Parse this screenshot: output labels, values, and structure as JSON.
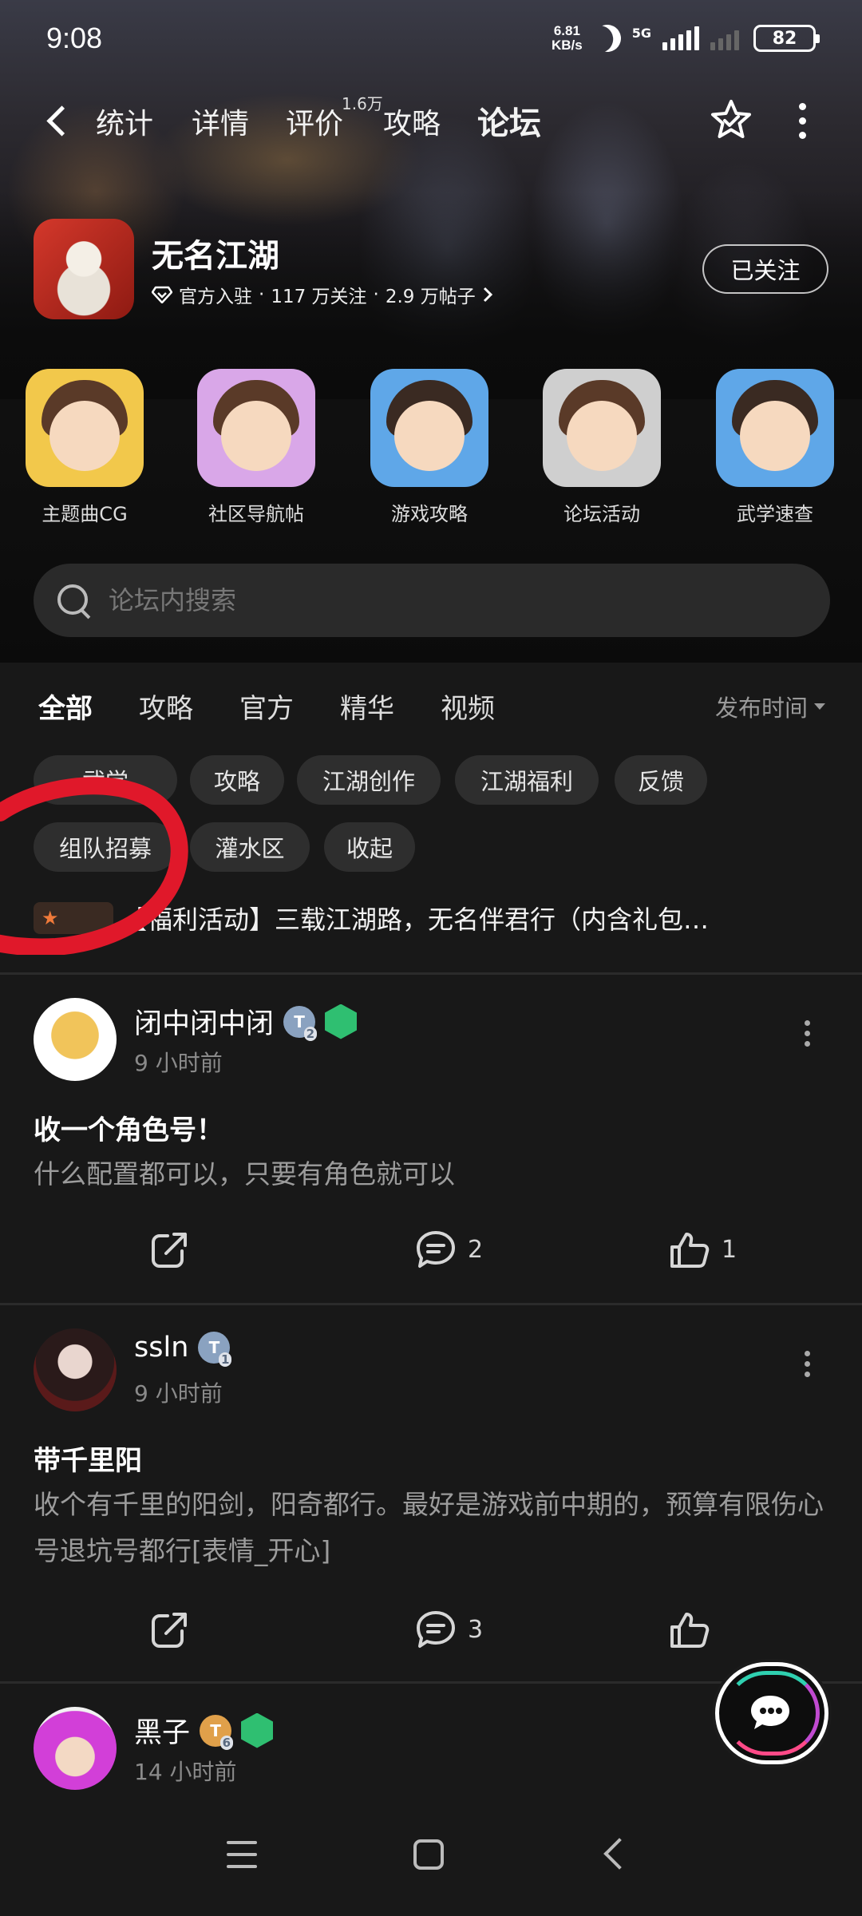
{
  "status_bar": {
    "time": "9:08",
    "net_speed_value": "6.81",
    "net_speed_unit": "KB/s",
    "network": "5G",
    "battery": "82"
  },
  "nav": {
    "tabs": [
      "统计",
      "详情",
      "评价",
      "攻略",
      "论坛"
    ],
    "active_tab": "论坛",
    "review_badge": "1.6万"
  },
  "game": {
    "title": "无名江湖",
    "official": "官方入驻",
    "followers": "117 万关注",
    "posts": "2.9 万帖子",
    "follow_label": "已关注"
  },
  "shortcuts": [
    {
      "label": "主题曲CG",
      "color": "#f2c84b"
    },
    {
      "label": "社区导航帖",
      "color": "#d9a7e8"
    },
    {
      "label": "游戏攻略",
      "color": "#5fa7e8"
    },
    {
      "label": "论坛活动",
      "color": "#cfcfcf"
    },
    {
      "label": "武学速查",
      "color": "#5fa7e8"
    }
  ],
  "search": {
    "placeholder": "论坛内搜索"
  },
  "forum_tabs": [
    "全部",
    "攻略",
    "官方",
    "精华",
    "视频"
  ],
  "forum_active_tab": "全部",
  "sort_label": "发布时间",
  "chips": [
    "武学",
    "攻略",
    "江湖创作",
    "江湖福利",
    "反馈",
    "组队招募",
    "灌水区",
    "收起"
  ],
  "pinned": {
    "text": "【福利活动】三载江湖路，无名伴君行（内含礼包…"
  },
  "posts": [
    {
      "author": "闭中闭中闭",
      "level": "2",
      "time": "9 小时前",
      "title": "收一个角色号！",
      "body": "什么配置都可以，只要有角色就可以",
      "comments": "2",
      "likes": "1"
    },
    {
      "author": "ssln",
      "level": "1",
      "time": "9 小时前",
      "title": "带千里阳",
      "body": "收个有千里的阳剑，阳奇都行。最好是游戏前中期的，预算有限伤心号退坑号都行[表情_开心]",
      "comments": "3",
      "likes": ""
    },
    {
      "author": "黑子",
      "level": "6",
      "time": "14 小时前"
    }
  ],
  "colors": {
    "accent": "#2fd0b0",
    "background": "#181818",
    "chip_bg": "#2e2e2e",
    "annotation": "#e0182a"
  }
}
